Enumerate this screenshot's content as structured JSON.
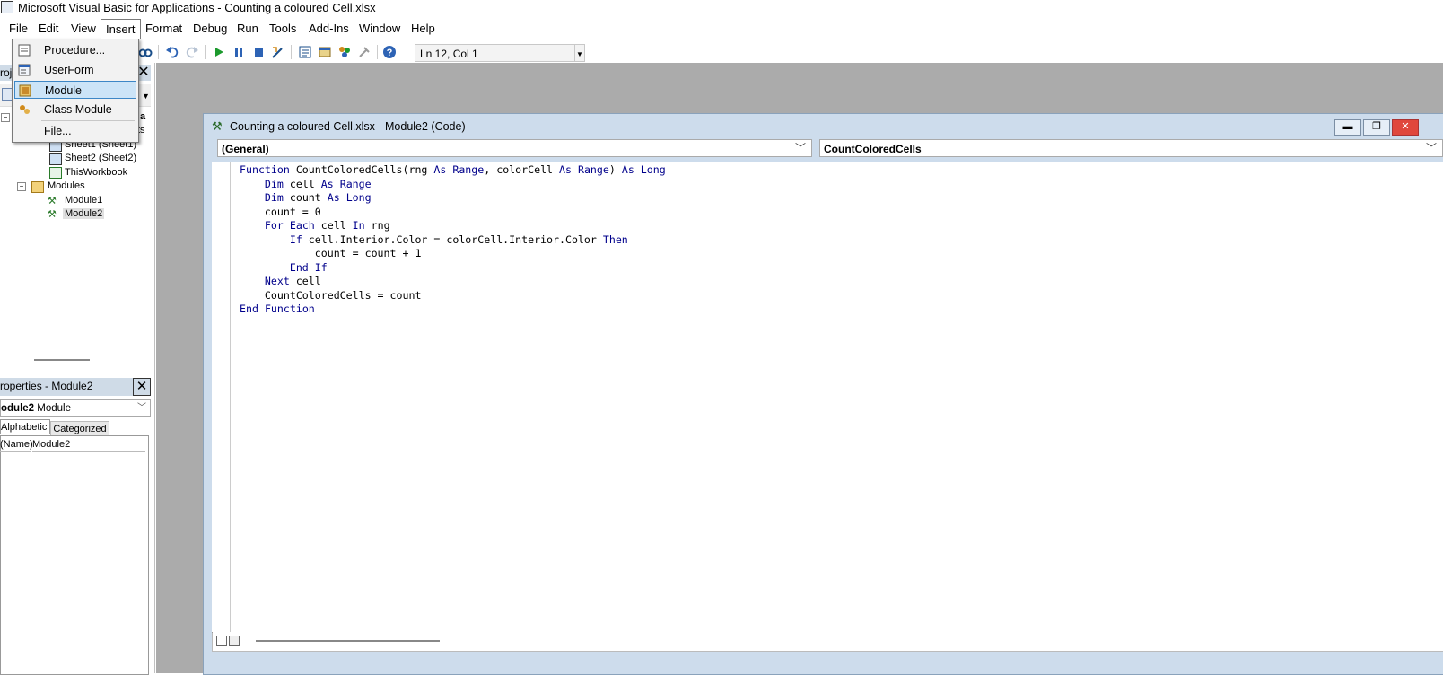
{
  "window": {
    "title": "Microsoft Visual Basic for Applications - Counting a coloured Cell.xlsx"
  },
  "menubar": {
    "items": [
      "File",
      "Edit",
      "View",
      "Insert",
      "Format",
      "Debug",
      "Run",
      "Tools",
      "Add-Ins",
      "Window",
      "Help"
    ],
    "open_menu": "Insert"
  },
  "insert_menu": {
    "items": [
      "Procedure...",
      "UserForm",
      "Module",
      "Class Module",
      "File..."
    ],
    "highlighted": "Module"
  },
  "toolbar": {
    "position": "Ln 12, Col 1"
  },
  "project": {
    "header": "roj",
    "tree": {
      "partial_labels": [
        "a",
        "ts"
      ],
      "items": [
        "Sheet1 (Sheet1)",
        "Sheet2 (Sheet2)",
        "ThisWorkbook",
        "Modules",
        "Module1",
        "Module2"
      ],
      "selected": "Module2"
    }
  },
  "properties": {
    "title": "roperties - Module2",
    "object_name": "odule2",
    "object_type": "Module",
    "tabs": [
      "Alphabetic",
      "Categorized"
    ],
    "rows": [
      {
        "key": "(Name)",
        "value": "Module2"
      }
    ]
  },
  "code_window": {
    "title": "Counting a coloured Cell.xlsx - Module2 (Code)",
    "object_combo": "(General)",
    "proc_combo": "CountColoredCells",
    "code": [
      "Function CountColoredCells(rng As Range, colorCell As Range) As Long",
      "    Dim cell As Range",
      "    Dim count As Long",
      "    count = 0",
      "    For Each cell In rng",
      "        If cell.Interior.Color = colorCell.Interior.Color Then",
      "            count = count + 1",
      "        End If",
      "    Next cell",
      "    CountColoredCells = count",
      "End Function",
      ""
    ]
  },
  "colors": {
    "mdi_background": "#ababab",
    "code_keyword": "#00008b",
    "menu_highlight": "#cce4f7",
    "panel_header": "#cfdbe7"
  }
}
